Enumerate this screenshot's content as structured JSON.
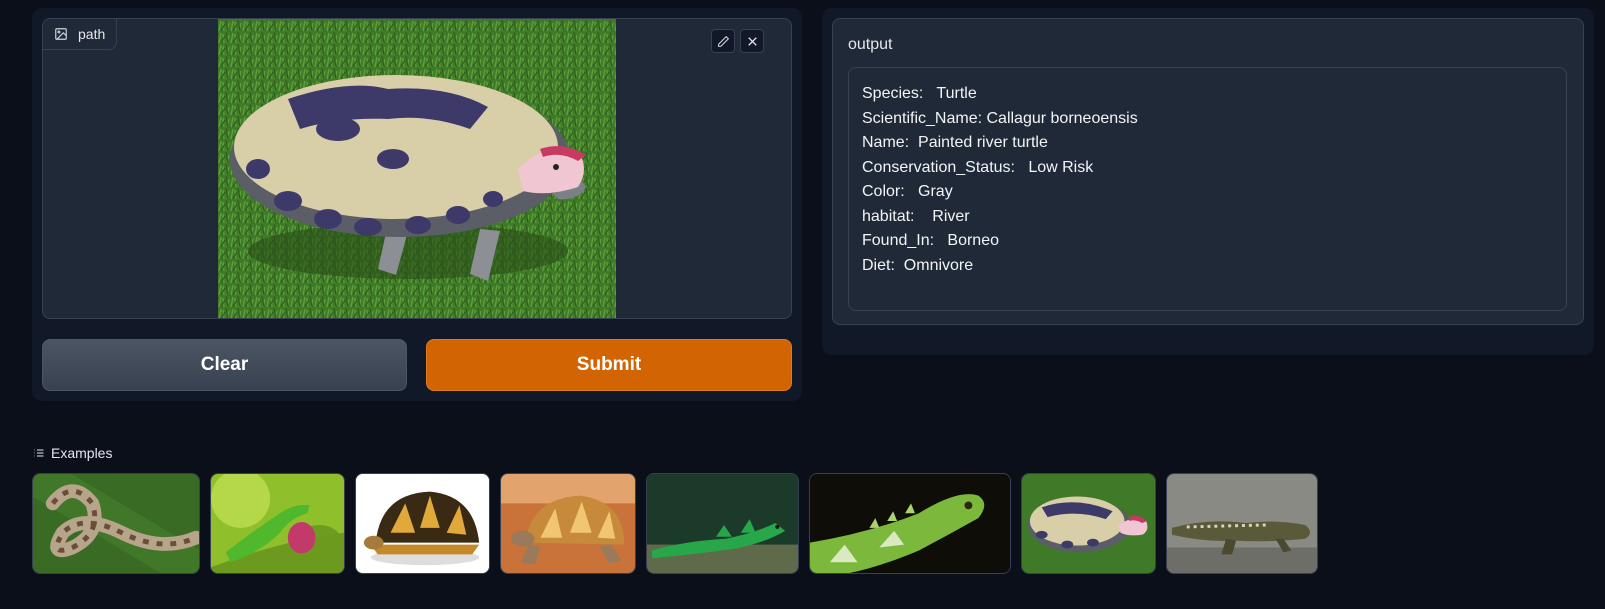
{
  "input": {
    "label": "path",
    "edit_icon": "pencil-icon",
    "close_icon": "close-icon"
  },
  "buttons": {
    "clear": "Clear",
    "submit": "Submit",
    "submit_color": "#d26404"
  },
  "output": {
    "label": "output",
    "lines": [
      "Species:   Turtle",
      "Scientific_Name: Callagur borneoensis",
      "Name:  Painted river turtle",
      "Conservation_Status:   Low Risk",
      "Color:   Gray",
      "habitat:    River",
      "Found_In:   Borneo",
      "Diet:  Omnivore"
    ]
  },
  "examples": {
    "label": "Examples",
    "items": [
      "snake",
      "green-anole",
      "star-tortoise",
      "radiated-tortoise",
      "green-basilisk",
      "iguana",
      "painted-turtle",
      "crocodile"
    ]
  }
}
